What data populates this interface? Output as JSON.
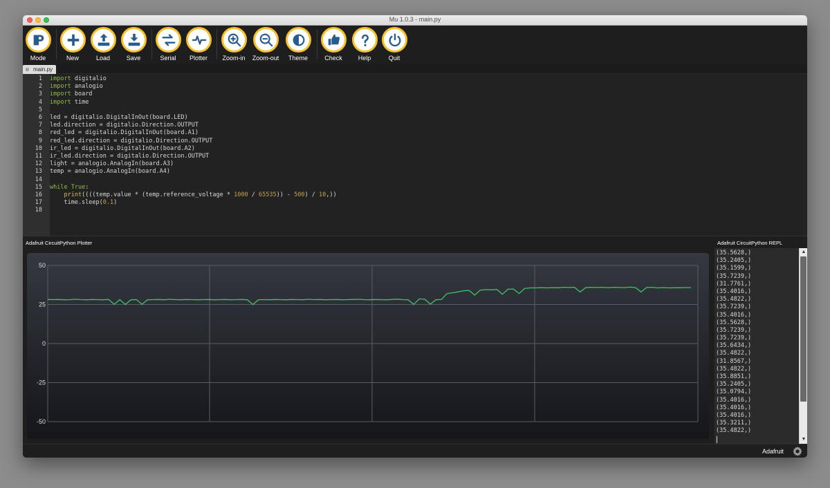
{
  "window": {
    "title": "Mu 1.0.3 - main.py"
  },
  "toolbar": {
    "buttons": [
      {
        "id": "mode",
        "label": "Mode",
        "icon": "mode-icon"
      },
      {
        "id": "new",
        "label": "New",
        "icon": "plus-icon"
      },
      {
        "id": "load",
        "label": "Load",
        "icon": "upload-icon"
      },
      {
        "id": "save",
        "label": "Save",
        "icon": "download-icon"
      },
      {
        "id": "serial",
        "label": "Serial",
        "icon": "swap-arrows-icon"
      },
      {
        "id": "plotter",
        "label": "Plotter",
        "icon": "pulse-icon"
      },
      {
        "id": "zoom_in",
        "label": "Zoom-in",
        "icon": "zoom-in-icon"
      },
      {
        "id": "zoom_out",
        "label": "Zoom-out",
        "icon": "zoom-out-icon"
      },
      {
        "id": "theme",
        "label": "Theme",
        "icon": "half-circle-icon"
      },
      {
        "id": "check",
        "label": "Check",
        "icon": "thumbs-up-icon"
      },
      {
        "id": "help",
        "label": "Help",
        "icon": "question-icon"
      },
      {
        "id": "quit",
        "label": "Quit",
        "icon": "power-icon"
      }
    ],
    "icon_accent": "#285c8e",
    "ring_color": "#f6c12c"
  },
  "tabs": [
    {
      "label": "main.py",
      "close": "⊗"
    }
  ],
  "editor": {
    "line_numbers": [
      "1",
      "2",
      "3",
      "4",
      "5",
      "6",
      "7",
      "8",
      "9",
      "10",
      "11",
      "12",
      "13",
      "14",
      "15",
      "16",
      "17",
      "18"
    ],
    "lines": [
      "import digitalio",
      "import analogio",
      "import board",
      "import time",
      "",
      "led = digitalio.DigitalInOut(board.LED)",
      "led.direction = digitalio.Direction.OUTPUT",
      "red_led = digitalio.DigitalInOut(board.A1)",
      "red_led.direction = digitalio.Direction.OUTPUT",
      "ir_led = digitalio.DigitalInOut(board.A2)",
      "ir_led.direction = digitalio.Direction.OUTPUT",
      "light = analogio.AnalogIn(board.A3)",
      "temp = analogio.AnalogIn(board.A4)",
      "",
      "while True:",
      "    print((((temp.value * (temp.reference_voltage * 1000 / 65535)) - 500) / 10,))",
      "    time.sleep(0.1)",
      ""
    ]
  },
  "plotter": {
    "title": "Adafruit CircuitPython Plotter",
    "line_color": "#3ec46d"
  },
  "chart_data": {
    "type": "line",
    "title": "",
    "xlabel": "",
    "ylabel": "",
    "ylim": [
      -50,
      50
    ],
    "yticks": [
      50,
      25,
      0,
      -25,
      -50
    ],
    "ytick_labels": [
      "50",
      "25",
      "0",
      "-25",
      "-50"
    ],
    "grid": true,
    "series": [
      {
        "values": [
          28.2,
          28.1,
          28.2,
          28.0,
          28.1,
          28.3,
          28.1,
          28.0,
          28.2,
          28.1,
          28.0,
          28.2,
          25.1,
          28.1,
          25.0,
          28.0,
          28.1,
          25.1,
          28.0,
          28.1,
          28.2,
          28.0,
          28.3,
          28.1,
          28.0,
          28.2,
          28.1,
          28.0,
          28.1,
          28.2,
          28.0,
          28.1,
          28.2,
          28.0,
          28.1,
          28.2,
          28.0,
          25.0,
          28.0,
          28.1,
          28.0,
          28.2,
          28.1,
          28.0,
          28.2,
          28.1,
          28.0,
          28.3,
          28.1,
          28.2,
          28.0,
          28.1,
          28.2,
          28.0,
          28.1,
          28.2,
          28.3,
          28.1,
          28.0,
          28.2,
          28.1,
          28.0,
          28.2,
          28.4,
          28.1,
          28.0,
          25.1,
          28.6,
          28.3,
          25.2,
          28.0,
          28.2,
          32.0,
          32.5,
          33.1,
          33.8,
          34.0,
          31.0,
          34.2,
          34.5,
          34.4,
          34.6,
          31.5,
          34.8,
          34.9,
          32.0,
          35.2,
          35.6,
          35.6,
          35.8,
          35.6,
          35.8,
          35.7,
          36.0,
          35.9,
          36.0,
          33.0,
          35.8,
          36.0,
          35.9,
          36.0,
          35.8,
          36.0,
          35.9,
          35.8,
          36.1,
          35.8,
          33.0,
          35.9,
          36.0,
          35.6,
          35.8,
          35.6,
          35.7,
          35.7,
          35.8,
          35.8
        ]
      }
    ]
  },
  "repl": {
    "title": "Adafruit CircuitPython REPL",
    "lines": [
      "(35.5628,)",
      "(35.2405,)",
      "(35.1599,)",
      "(35.7239,)",
      "(31.7761,)",
      "(35.4016,)",
      "(35.4822,)",
      "(35.7239,)",
      "(35.4016,)",
      "(35.5628,)",
      "(35.7239,)",
      "(35.7239,)",
      "(35.6434,)",
      "(35.4822,)",
      "(31.8567,)",
      "(35.4822,)",
      "(35.8851,)",
      "(35.2405,)",
      "(35.0794,)",
      "(35.4016,)",
      "(35.4016,)",
      "(35.4016,)",
      "(35.3211,)",
      "(35.4822,)"
    ],
    "scroll_up": "▲",
    "scroll_down": "▼"
  },
  "status": {
    "mode": "Adafruit"
  }
}
